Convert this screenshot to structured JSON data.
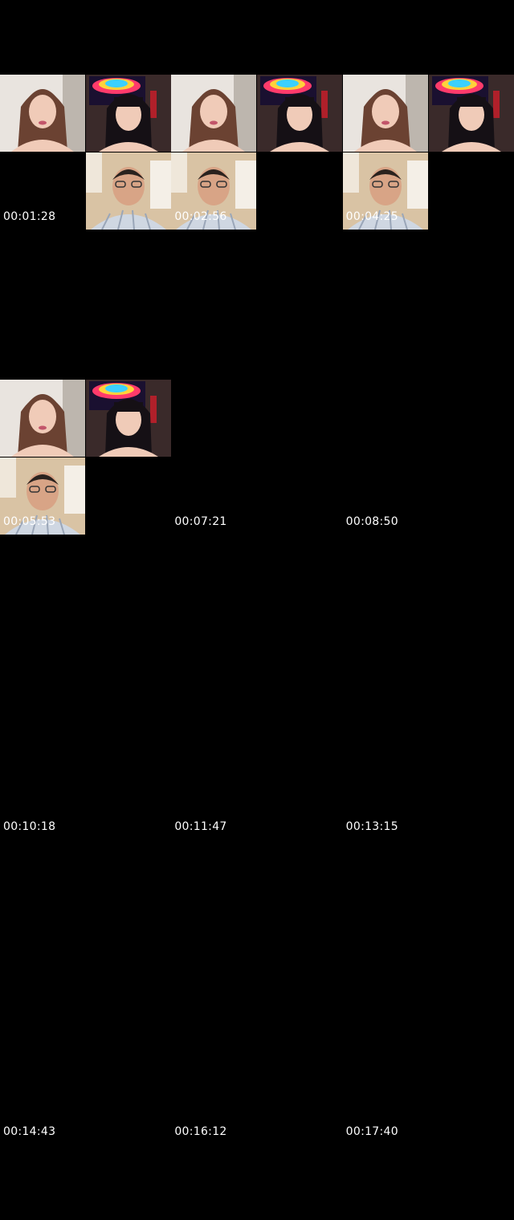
{
  "timestamps": [
    "00:01:28",
    "00:02:56",
    "00:04:25",
    "00:05:53",
    "00:07:21",
    "00:08:50",
    "00:10:18",
    "00:11:47",
    "00:13:15",
    "00:14:43",
    "00:16:12",
    "00:17:40"
  ],
  "colors": {
    "background": "#000000",
    "timestamp_text": "#ffffff",
    "woman_room": "#e9e4df",
    "hair_brown": "#6b4232",
    "hair_black": "#151015",
    "skin": "#f0cbb8",
    "man_room": "#d9c3a4",
    "shirt_plaid": "#cfd7e2"
  }
}
